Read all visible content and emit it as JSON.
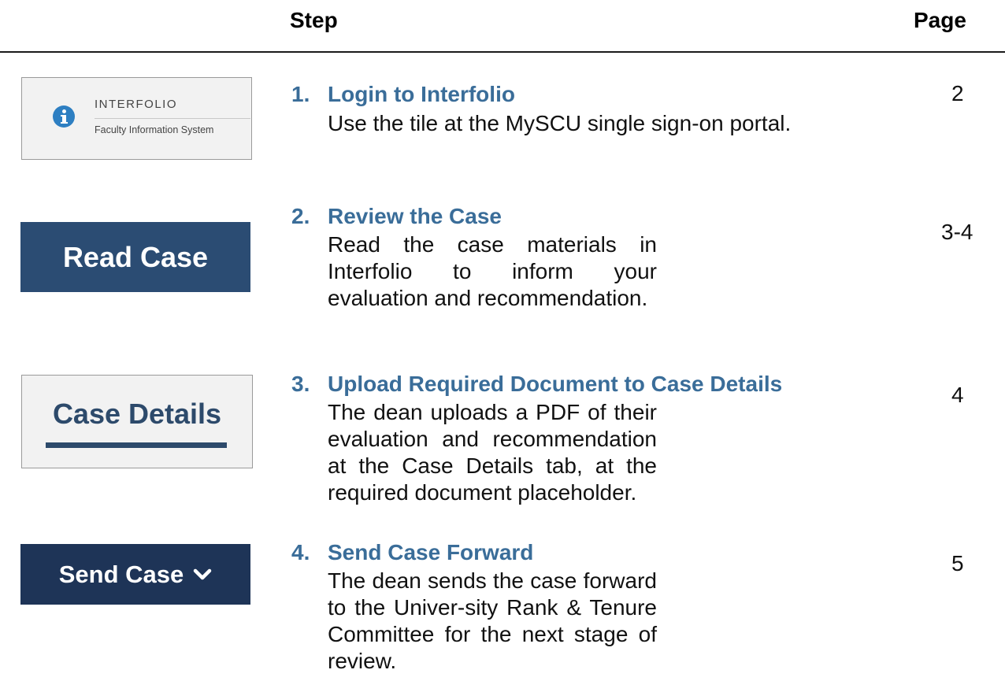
{
  "header": {
    "step_label": "Step",
    "page_label": "Page"
  },
  "steps": [
    {
      "number": "1.",
      "title": "Login to Interfolio",
      "description": "Use the tile at the MySCU single sign-on portal.",
      "page": "2",
      "thumbnail": {
        "brand": "INTERFOLIO",
        "subtitle": "Faculty Information System",
        "icon": "info-icon",
        "icon_color": "#2e7fc2"
      }
    },
    {
      "number": "2.",
      "title": "Review the Case",
      "description": "Read the case materials in Interfolio to inform your evaluation and recommendation.",
      "page": "3-4",
      "thumbnail": {
        "label": "Read Case",
        "color": "#2b4c73"
      }
    },
    {
      "number": "3.",
      "title": "Upload Required Document to Case Details",
      "description": "The dean uploads a PDF of their evaluation and recommendation at the Case Details tab, at the required document placeholder.",
      "page": "4",
      "thumbnail": {
        "label": "Case Details",
        "color": "#2d4a6b"
      }
    },
    {
      "number": "4.",
      "title": "Send Case Forward",
      "description": "The dean sends the case forward to the Univer-sity Rank & Tenure Committee for the next stage of review.",
      "page": "5",
      "thumbnail": {
        "label": "Send Case",
        "icon": "chevron-down-icon",
        "color": "#1e3457"
      }
    }
  ],
  "colors": {
    "step_title": "#3a6d99",
    "text": "#111111"
  }
}
